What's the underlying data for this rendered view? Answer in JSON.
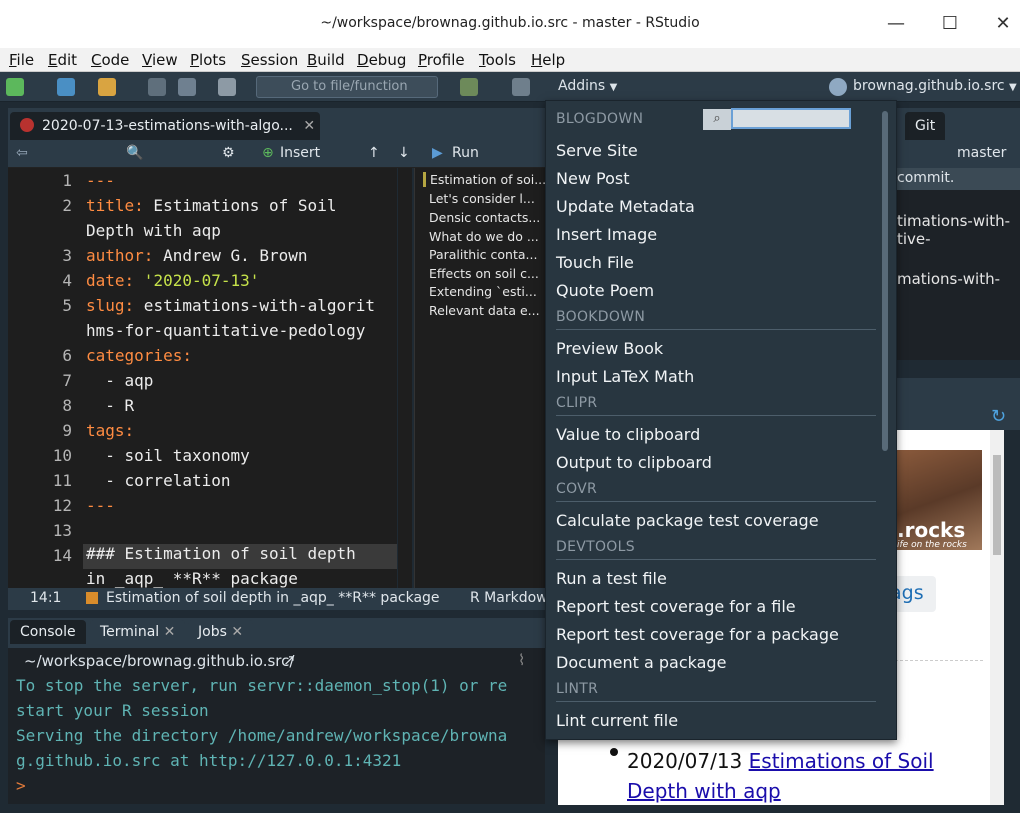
{
  "window": {
    "title": "~/workspace/brownag.github.io.src - master - RStudio",
    "minimize": "—",
    "maximize": "☐",
    "close": "✕"
  },
  "menu": [
    "File",
    "Edit",
    "Code",
    "View",
    "Plots",
    "Session",
    "Build",
    "Debug",
    "Profile",
    "Tools",
    "Help"
  ],
  "toolbar": {
    "goto_placeholder": "Go to file/function",
    "addins_label": "Addins",
    "project_label": "brownag.github.io.src"
  },
  "editor": {
    "tab_label": "2020-07-13-estimations-with-algo...",
    "insert_label": "Insert",
    "run_label": "Run",
    "lines": [
      {
        "n": "1",
        "text": "---"
      },
      {
        "n": "2",
        "key": "title:",
        "rest": " Estimations of Soil"
      },
      {
        "n": "",
        "rest": "Depth with aqp"
      },
      {
        "n": "3",
        "key": "author:",
        "rest": " Andrew G. Brown"
      },
      {
        "n": "4",
        "key": "date:",
        "str": " '2020-07-13'"
      },
      {
        "n": "5",
        "key": "slug:",
        "rest": " estimations-with-algorit"
      },
      {
        "n": "",
        "rest": "hms-for-quantitative-pedology"
      },
      {
        "n": "6",
        "key": "categories:"
      },
      {
        "n": "7",
        "rest": "  - aqp"
      },
      {
        "n": "8",
        "rest": "  - R"
      },
      {
        "n": "9",
        "key": "tags:"
      },
      {
        "n": "10",
        "rest": "  - soil taxonomy"
      },
      {
        "n": "11",
        "rest": "  - correlation"
      },
      {
        "n": "12",
        "rest": "---"
      },
      {
        "n": "13",
        "rest": ""
      },
      {
        "n": "14",
        "rest": "### Estimation of soil depth"
      },
      {
        "n": "",
        "rest": "in _aqp_ **R** package"
      }
    ],
    "outline": [
      "Estimation of soi...",
      "Let's consider l...",
      "Densic contacts...",
      "What do we do ...",
      "Paralithic conta...",
      "Effects on soil c...",
      "Extending `esti...",
      "Relevant data e..."
    ],
    "status_pos": "14:1",
    "status_section": "Estimation of soil depth in _aqp_ **R** package",
    "status_mode": "R Markdown"
  },
  "console": {
    "tabs": [
      "Console",
      "Terminal",
      "Jobs"
    ],
    "path": "~/workspace/brownag.github.io.src/",
    "lines": [
      "To stop the server, run servr::daemon_stop(1) or re",
      "start your R session",
      "Serving the directory /home/andrew/workspace/browna",
      "g.github.io.src at http://127.0.0.1:4321"
    ],
    "prompt": ">"
  },
  "git_pane": {
    "tab": "Git",
    "branch": "master",
    "commit_text": "commit.",
    "files": [
      "timations-with-",
      "tive-",
      "mations-with-"
    ]
  },
  "viewer": {
    "rocks_text": ".rocks",
    "rocks_sub": "ife on the rocks",
    "tags_btn": "ags",
    "post_date": "2020/07/13",
    "post_link": "Estimations of Soil Depth with aqp"
  },
  "addins": {
    "groups": [
      {
        "header": "BLOGDOWN",
        "items": [
          "Serve Site",
          "New Post",
          "Update Metadata",
          "Insert Image",
          "Touch File",
          "Quote Poem"
        ]
      },
      {
        "header": "BOOKDOWN",
        "items": [
          "Preview Book",
          "Input LaTeX Math"
        ]
      },
      {
        "header": "CLIPR",
        "items": [
          "Value to clipboard",
          "Output to clipboard"
        ]
      },
      {
        "header": "COVR",
        "items": [
          "Calculate package test coverage"
        ]
      },
      {
        "header": "DEVTOOLS",
        "items": [
          "Run a test file",
          "Report test coverage for a file",
          "Report test coverage for a package",
          "Document a package"
        ]
      },
      {
        "header": "LINTR",
        "items": [
          "Lint current file"
        ]
      }
    ],
    "search_value": ""
  }
}
